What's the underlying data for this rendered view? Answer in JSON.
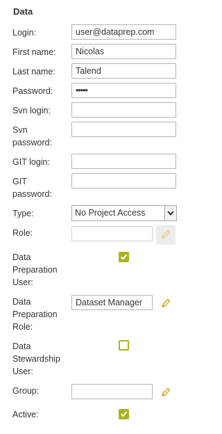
{
  "section": {
    "title": "Data"
  },
  "labels": {
    "login": "Login:",
    "first_name": "First name:",
    "last_name": "Last name:",
    "password": "Password:",
    "svn_login": "Svn login:",
    "svn_password_1": "Svn",
    "svn_password_2": "password:",
    "git_login": "GIT login:",
    "git_password_1": "GIT",
    "git_password_2": "password:",
    "type": "Type:",
    "role": "Role:",
    "dp_user_1": "Data",
    "dp_user_2": "Preparation",
    "dp_user_3": "User:",
    "dp_role_1": "Data",
    "dp_role_2": "Preparation",
    "dp_role_3": "Role:",
    "ds_user_1": "Data",
    "ds_user_2": "Stewardship",
    "ds_user_3": "User:",
    "group": "Group:",
    "active": "Active:"
  },
  "fields": {
    "login": "user@dataprep.com",
    "first_name": "Nicolas",
    "last_name": "Talend",
    "password": "•••••",
    "svn_login": "",
    "svn_password": "",
    "git_login": "",
    "git_password": "",
    "type": "No Project Access",
    "role": "",
    "dp_role": "Dataset Manager",
    "group": ""
  },
  "checks": {
    "data_preparation_user": true,
    "data_stewardship_user": false,
    "active": true
  },
  "colors": {
    "accent": "#aab223",
    "pencil": "#d8a21a",
    "pencil_disabled": "#e8c98a"
  },
  "icons": {
    "dropdown": "chevron-down-icon",
    "edit": "pencil-icon",
    "check": "check-icon"
  }
}
